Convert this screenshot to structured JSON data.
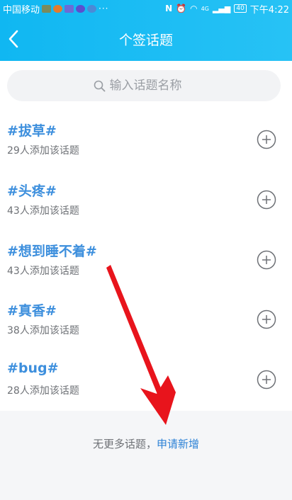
{
  "status_bar": {
    "carrier": "中国移动",
    "network_badge": "4G",
    "battery": "40",
    "time": "下午4:22"
  },
  "header": {
    "title": "个签话题"
  },
  "search": {
    "placeholder": "输入话题名称"
  },
  "topics": [
    {
      "title": "#拔草#",
      "count": "29人添加该话题"
    },
    {
      "title": "#头疼#",
      "count": "43人添加该话题"
    },
    {
      "title": "#想到睡不着#",
      "count": "43人添加该话题"
    },
    {
      "title": "#真香#",
      "count": "38人添加该话题"
    },
    {
      "title": "#bug#",
      "count": "28人添加该话题"
    }
  ],
  "footer": {
    "no_more_text": "无更多话题，",
    "request_link": "申请新增"
  },
  "colors": {
    "header_bg": "#10b7f2",
    "topic_title": "#3d8fdd",
    "link": "#2d82d6",
    "annotation_arrow": "#e8141c"
  },
  "icons": {
    "back": "chevron-left-icon",
    "search": "search-icon",
    "add": "plus-circle-icon"
  }
}
